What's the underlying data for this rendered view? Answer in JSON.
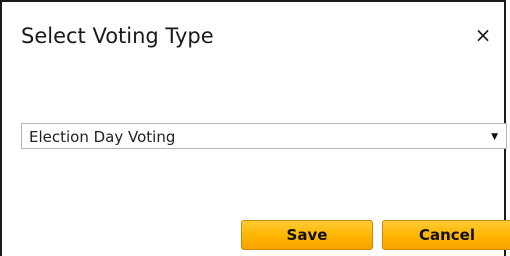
{
  "dialog": {
    "title": "Select Voting Type",
    "close_label": "×"
  },
  "voting_type": {
    "selected": "Election Day Voting",
    "arrow": "▼"
  },
  "buttons": {
    "save_label": "Save",
    "cancel_label": "Cancel"
  },
  "colors": {
    "button_accent": "#ffb400",
    "border": "#1a1a1a"
  }
}
